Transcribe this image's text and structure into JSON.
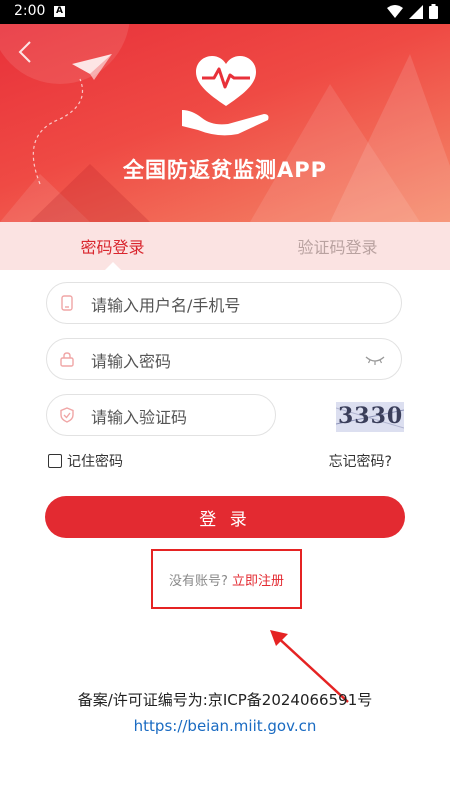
{
  "status_bar": {
    "time": "2:00",
    "notification_glyph": "A"
  },
  "header": {
    "title": "全国防返贫监测APP"
  },
  "tabs": {
    "password_login": "密码登录",
    "code_login": "验证码登录"
  },
  "form": {
    "username_placeholder": "请输入用户名/手机号",
    "password_placeholder": "请输入密码",
    "captcha_placeholder": "请输入验证码",
    "captcha_text": "3330",
    "remember_label": "记住密码",
    "forgot_label": "忘记密码?",
    "login_label": "登 录"
  },
  "register": {
    "prompt": "没有账号?",
    "link": "立即注册"
  },
  "footer": {
    "icp": "备案/许可证编号为:京ICP备2024066591号",
    "site": "https://beian.miit.gov.cn"
  },
  "colors": {
    "brand_red": "#e32a31",
    "tab_bg": "#fbe3e2",
    "link_blue": "#1a6bc2"
  }
}
